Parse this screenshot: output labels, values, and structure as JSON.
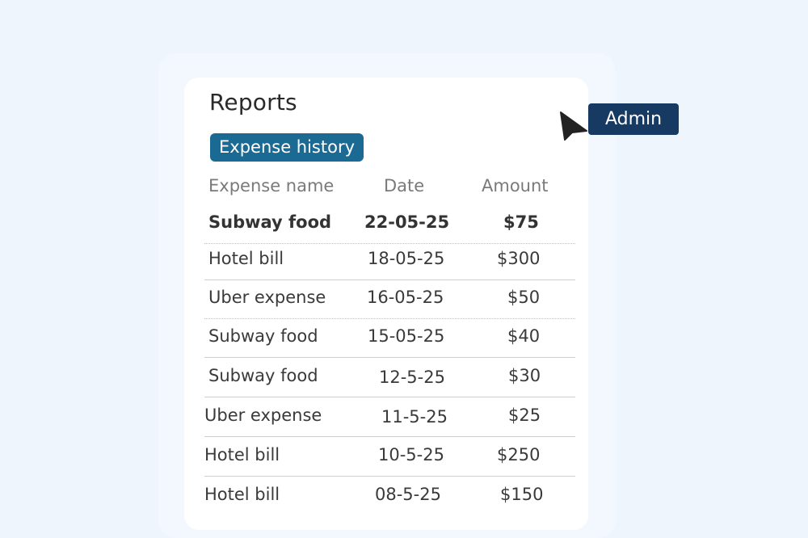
{
  "page": {
    "title": "Reports",
    "tab_label": "Expense history"
  },
  "table": {
    "columns": [
      "Expense name",
      "Date",
      "Amount"
    ],
    "rows": [
      {
        "name": "Subway food",
        "date": "22-05-25",
        "amount": "$75",
        "highlighted": true
      },
      {
        "name": "Hotel bill",
        "date": "18-05-25",
        "amount": "$300"
      },
      {
        "name": "Uber expense",
        "date": "16-05-25",
        "amount": "$50"
      },
      {
        "name": "Subway food",
        "date": "15-05-25",
        "amount": "$40"
      },
      {
        "name": "Subway food",
        "date": "12-5-25",
        "amount": "$30"
      },
      {
        "name": "Uber expense",
        "date": "11-5-25",
        "amount": "$25"
      },
      {
        "name": "Hotel bill",
        "date": "10-5-25",
        "amount": "$250"
      },
      {
        "name": "Hotel bill",
        "date": "08-5-25",
        "amount": "$150"
      }
    ]
  },
  "cursor_tag": {
    "label": "Admin"
  },
  "colors": {
    "background": "#eef5fd",
    "tab_pill": "#1b6a93",
    "admin_tag": "#163a61",
    "cursor": "#222222"
  },
  "icons": {
    "cursor": "mouse-pointer-icon"
  }
}
